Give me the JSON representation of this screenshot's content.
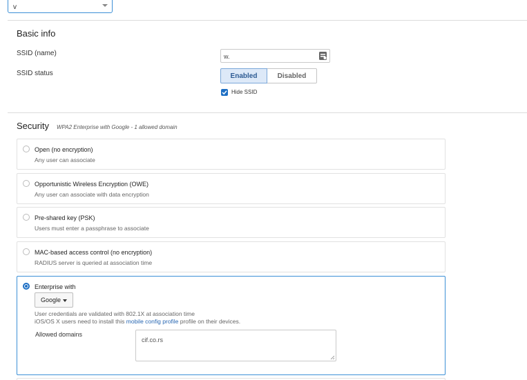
{
  "top_select": {
    "value": "v"
  },
  "basic_info": {
    "title": "Basic info",
    "ssid_label": "SSID (name)",
    "ssid_value": "w.",
    "ssid_status_label": "SSID status",
    "status_enabled": "Enabled",
    "status_disabled": "Disabled",
    "hide_ssid_label": "Hide SSID",
    "hide_ssid_checked": true
  },
  "security": {
    "title": "Security",
    "subtitle": "WPA2 Enterprise with Google - 1 allowed domain",
    "options": [
      {
        "title": "Open (no encryption)",
        "desc": "Any user can associate",
        "selected": false
      },
      {
        "title": "Opportunistic Wireless Encryption (OWE)",
        "desc": "Any user can associate with data encryption",
        "selected": false
      },
      {
        "title": "Pre-shared key (PSK)",
        "desc": "Users must enter a passphrase to associate",
        "selected": false
      },
      {
        "title": "MAC-based access control (no encryption)",
        "desc": "RADIUS server is queried at association time",
        "selected": false
      }
    ],
    "enterprise": {
      "title": "Enterprise with",
      "provider": "Google",
      "desc1": "User credentials are validated with 802.1X at association time",
      "desc2_before": "iOS/OS X users need to install this ",
      "desc2_link": "mobile config profile",
      "desc2_after": " profile on their devices.",
      "allowed_domains_label": "Allowed domains",
      "allowed_domains_value": "cif.co.rs",
      "selected": true
    }
  },
  "colors": {
    "accent": "#1e6fc4",
    "link": "#2867b2",
    "border_active": "#3b8fd6"
  }
}
